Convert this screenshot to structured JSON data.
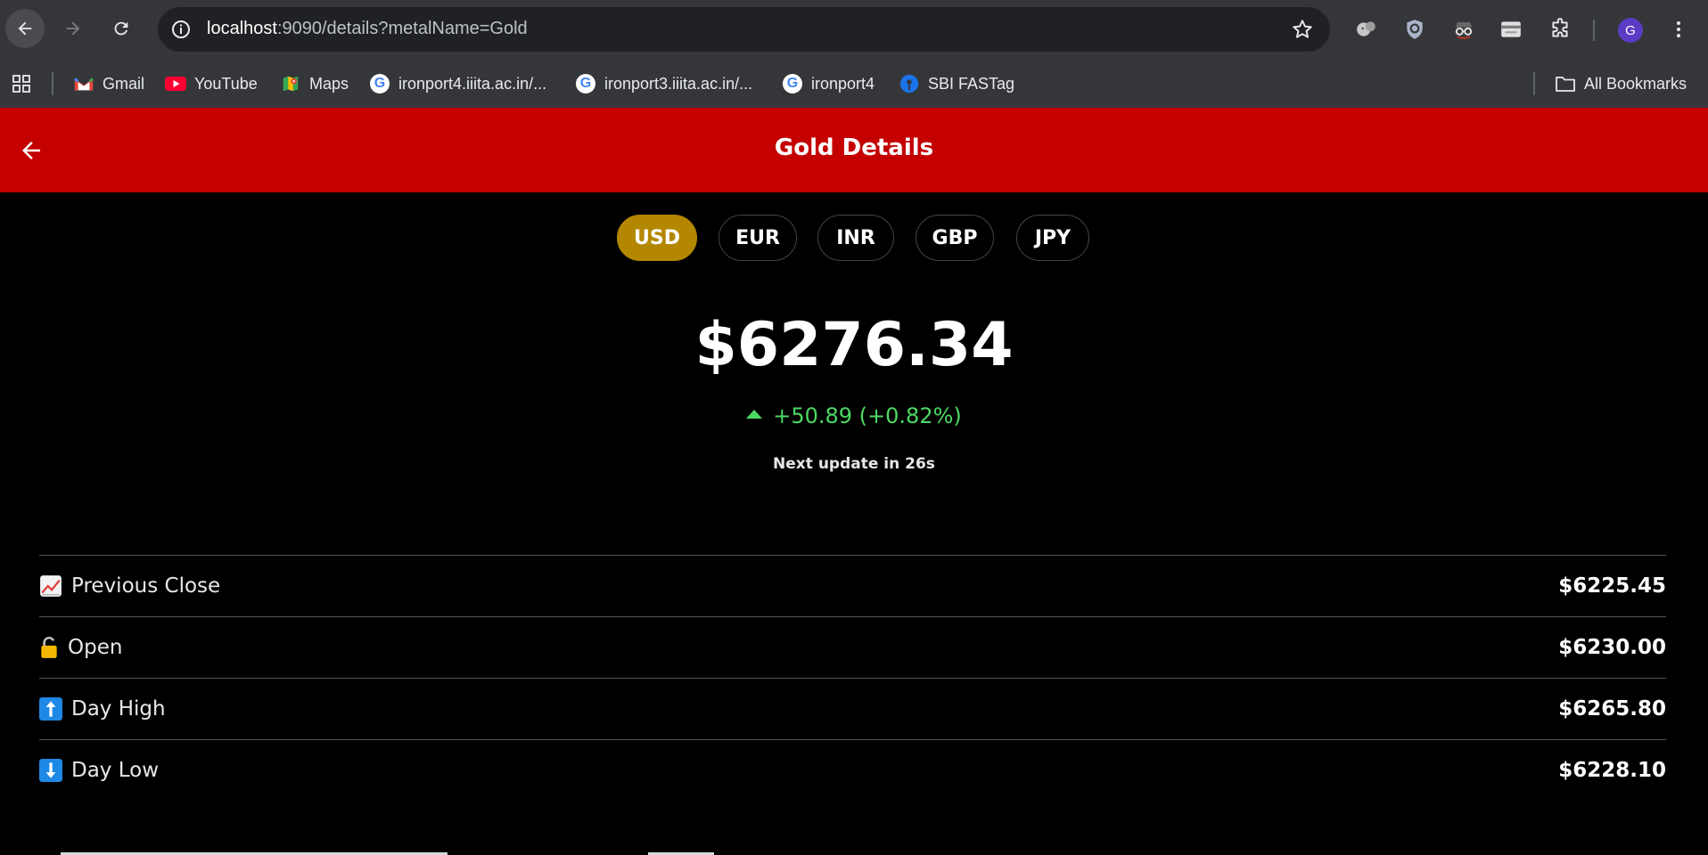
{
  "browser": {
    "url_host": "localhost",
    "url_path": ":9090/details?metalName=Gold",
    "profile_initial": "G",
    "bookmarks": [
      {
        "label": "Gmail",
        "icon": "gmail-icon"
      },
      {
        "label": "YouTube",
        "icon": "youtube-icon"
      },
      {
        "label": "Maps",
        "icon": "maps-icon"
      },
      {
        "label": "ironport4.iiita.ac.in/...",
        "icon": "google-icon"
      },
      {
        "label": "ironport3.iiita.ac.in/...",
        "icon": "google-icon"
      },
      {
        "label": "ironport4",
        "icon": "google-icon"
      },
      {
        "label": "SBI FASTag",
        "icon": "sbi-icon"
      }
    ],
    "all_bookmarks_label": "All Bookmarks"
  },
  "header": {
    "title": "Gold Details"
  },
  "currencies": {
    "options": [
      "USD",
      "EUR",
      "INR",
      "GBP",
      "JPY"
    ],
    "selected": "USD"
  },
  "price": {
    "current": "$6276.34",
    "change": "+50.89 (+0.82%)",
    "direction": "up",
    "next_update": "Next update in 26s"
  },
  "stats": [
    {
      "icon": "chart-increasing-icon",
      "label": "Previous Close",
      "value": "$6225.45"
    },
    {
      "icon": "unlocked-icon",
      "label": "Open",
      "value": "$6230.00"
    },
    {
      "icon": "up-arrow-icon",
      "label": "Day High",
      "value": "$6265.80"
    },
    {
      "icon": "down-arrow-icon",
      "label": "Day Low",
      "value": "$6228.10"
    }
  ],
  "colors": {
    "header_bg": "#c40000",
    "active_currency": "#b38800",
    "positive_change": "#4cd964"
  }
}
